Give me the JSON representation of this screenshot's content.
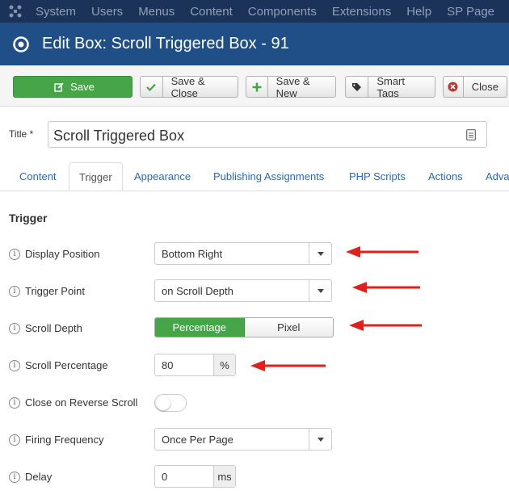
{
  "topbar": {
    "items": [
      "System",
      "Users",
      "Menus",
      "Content",
      "Components",
      "Extensions",
      "Help",
      "SP Page"
    ]
  },
  "header": {
    "title": "Edit Box: Scroll Triggered Box - 91"
  },
  "toolbar": {
    "save": "Save",
    "save_close": "Save & Close",
    "save_new": "Save & New",
    "smart_tags": "Smart Tags",
    "close": "Close"
  },
  "title_field": {
    "label": "Title *",
    "value": "Scroll Triggered Box"
  },
  "tabs": [
    "Content",
    "Trigger",
    "Appearance",
    "Publishing Assignments",
    "PHP Scripts",
    "Actions",
    "Advanced"
  ],
  "active_tab": "Trigger",
  "section": {
    "title": "Trigger"
  },
  "fields": {
    "display_position": {
      "label": "Display Position",
      "value": "Bottom Right"
    },
    "trigger_point": {
      "label": "Trigger Point",
      "value": "on Scroll Depth"
    },
    "scroll_depth": {
      "label": "Scroll Depth",
      "options": [
        "Percentage",
        "Pixel"
      ],
      "selected": "Percentage"
    },
    "scroll_percentage": {
      "label": "Scroll Percentage",
      "value": "80",
      "unit": "%"
    },
    "close_on_reverse": {
      "label": "Close on Reverse Scroll",
      "enabled": false
    },
    "firing_frequency": {
      "label": "Firing Frequency",
      "value": "Once Per Page"
    },
    "delay": {
      "label": "Delay",
      "value": "0",
      "unit": "ms"
    }
  },
  "colors": {
    "topbar": "#1b3358",
    "header": "#1f4f86",
    "save_green": "#46a546",
    "link_blue": "#2a69b8",
    "annotation_red": "#e0201b"
  },
  "icons": {
    "info": "i"
  }
}
